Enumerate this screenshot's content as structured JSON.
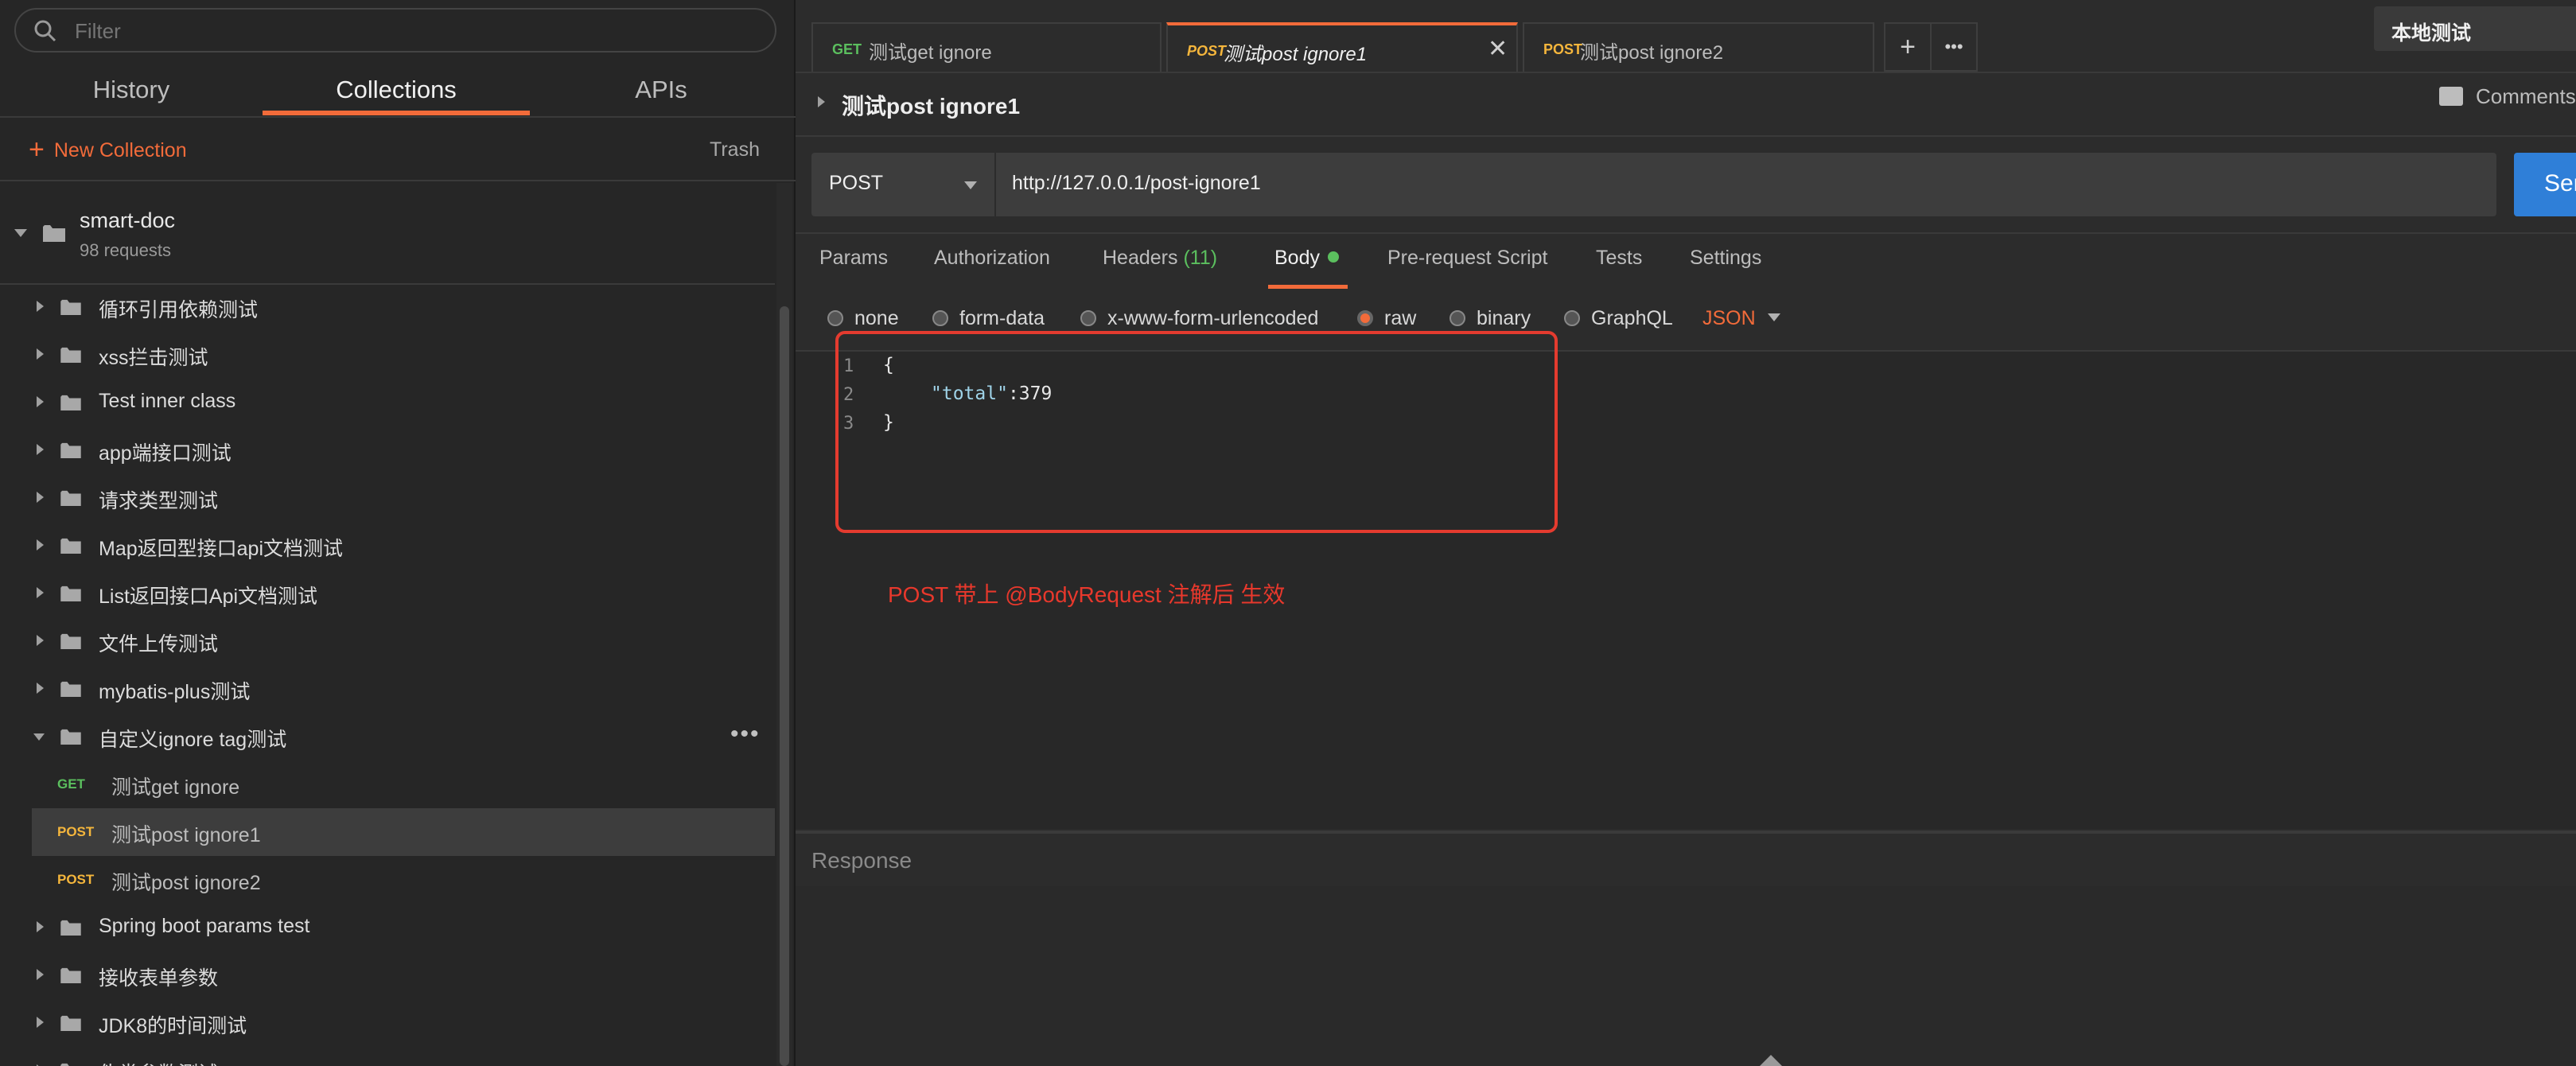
{
  "search": {
    "placeholder": "Filter"
  },
  "sidebar": {
    "tabs": [
      "History",
      "Collections",
      "APIs"
    ],
    "new_collection_label": "New Collection",
    "trash_label": "Trash",
    "collection": {
      "name": "smart-doc",
      "count": "98 requests"
    },
    "tree": [
      {
        "label": "循环引用依赖测试"
      },
      {
        "label": "xss拦击测试"
      },
      {
        "label": "Test inner class"
      },
      {
        "label": "app端接口测试"
      },
      {
        "label": "请求类型测试"
      },
      {
        "label": "Map返回型接口api文档测试"
      },
      {
        "label": "List返回接口Api文档测试"
      },
      {
        "label": "文件上传测试"
      },
      {
        "label": "mybatis-plus测试"
      },
      {
        "label": "自定义ignore tag测试"
      },
      {
        "method": "GET",
        "label": "测试get ignore"
      },
      {
        "method": "POST",
        "label": "测试post ignore1"
      },
      {
        "method": "POST",
        "label": "测试post ignore2"
      },
      {
        "label": "Spring boot params test"
      },
      {
        "label": "接收表单参数"
      },
      {
        "label": "JDK8的时间测试"
      },
      {
        "label": "伪类参数测试"
      }
    ]
  },
  "tabs": [
    {
      "method": "GET",
      "title": "测试get ignore"
    },
    {
      "method": "POST",
      "title": "测试post ignore1"
    },
    {
      "method": "POST",
      "title": "测试post ignore2"
    }
  ],
  "tab_actions": {
    "add": "+",
    "more": "•••"
  },
  "environment": "本地测试",
  "request": {
    "title": "测试post ignore1",
    "comments_label": "Comments",
    "method": "POST",
    "url": "http://127.0.0.1/post-ignore1",
    "send_label": "Send"
  },
  "param_tabs": {
    "params": "Params",
    "authorization": "Authorization",
    "headers": "Headers",
    "headers_count": "(11)",
    "body": "Body",
    "pre_request": "Pre-request Script",
    "tests": "Tests",
    "settings": "Settings"
  },
  "body_types": [
    "none",
    "form-data",
    "x-www-form-urlencoded",
    "raw",
    "binary",
    "GraphQL"
  ],
  "body_lang": "JSON",
  "editor": {
    "lines": [
      "1",
      "2",
      "3"
    ],
    "open_brace": "{",
    "key": "\"total\"",
    "sep": ":",
    "value": "379",
    "close_brace": "}"
  },
  "annotation": "POST 带上 @BodyRequest  注解后 生效",
  "response_label": "Response",
  "colors": {
    "accent": "#f26b3a",
    "get": "#5bbf5e",
    "post": "#f5b63c",
    "annotation_red": "#e43b2f",
    "send": "#2f7fd8"
  },
  "icons": [
    "search-icon",
    "plus-icon",
    "caret-right-icon",
    "caret-down-icon",
    "folder-icon",
    "close-icon",
    "more-icon",
    "comment-icon"
  ]
}
